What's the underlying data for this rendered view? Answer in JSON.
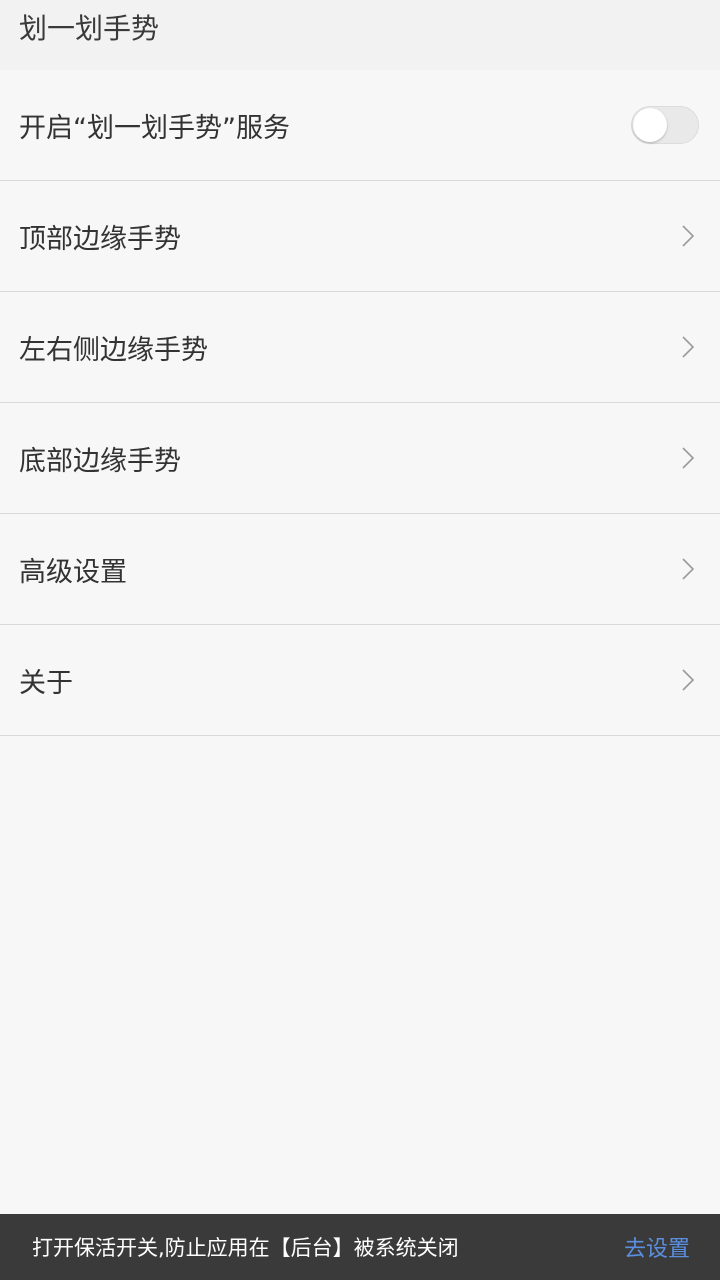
{
  "app_bar": {
    "title": "划一划手势"
  },
  "settings": {
    "service_toggle": {
      "label": "开启“划一划手势”服务",
      "enabled": false
    },
    "items": [
      {
        "label": "顶部边缘手势",
        "icon": "chevron-right-icon"
      },
      {
        "label": "左右侧边缘手势",
        "icon": "chevron-right-icon"
      },
      {
        "label": "底部边缘手势",
        "icon": "chevron-right-icon"
      },
      {
        "label": "高级设置",
        "icon": "chevron-right-icon"
      },
      {
        "label": "关于",
        "icon": "chevron-right-icon"
      }
    ]
  },
  "snackbar": {
    "message": "打开保活开关,防止应用在【后台】被系统关闭",
    "action_label": "去设置",
    "action_color": "#5b8fe0"
  }
}
